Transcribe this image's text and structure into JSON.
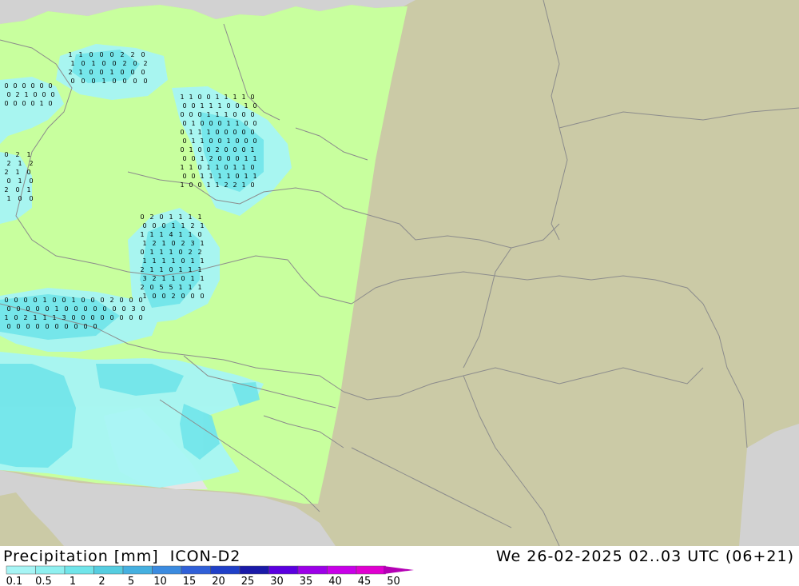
{
  "header": {
    "variable": "Precipitation [mm]",
    "model": "ICON-D2",
    "valid_time": "We 26-02-2025 02..03 UTC (06+21)"
  },
  "legend": {
    "ticks": [
      "0.1",
      "0.5",
      "1",
      "2",
      "5",
      "10",
      "15",
      "20",
      "25",
      "30",
      "35",
      "40",
      "45",
      "50"
    ],
    "colors": [
      "#a7f5f5",
      "#8ff0f0",
      "#70e5ea",
      "#55cde0",
      "#45b0e0",
      "#3b8be0",
      "#3060d8",
      "#2040c8",
      "#1a1aa8",
      "#5b00e0",
      "#9c00e8",
      "#c800e8",
      "#e000d0",
      "#b400b4"
    ]
  },
  "map": {
    "colors": {
      "domain": "#c8ff9e",
      "outside": "#cbcaa6",
      "sea": "#d2d2d2",
      "border": "#8c8c8c",
      "rain_light": "#a7f5f5",
      "rain_mid": "#70e5ea",
      "value_text": "#000000"
    },
    "values": [
      "1",
      "1",
      "0",
      "0",
      "0",
      "2",
      "2",
      "0",
      "1",
      "0",
      "1",
      "0",
      "0",
      "2",
      "0",
      "2",
      "2",
      "1",
      "0",
      "0",
      "1",
      "0",
      "0",
      "0",
      "0",
      "0",
      "0",
      "1",
      "0",
      "0",
      "0",
      "0",
      "0",
      "0",
      "0",
      "0",
      "0",
      "0",
      "0",
      "2",
      "1",
      "0",
      "0",
      "0",
      "0",
      "0",
      "0",
      "0",
      "1",
      "0",
      "1",
      "1",
      "0",
      "0",
      "1",
      "1",
      "1",
      "1",
      "0",
      "0",
      "0",
      "1",
      "1",
      "1",
      "0",
      "0",
      "1",
      "0",
      "0",
      "0",
      "0",
      "1",
      "1",
      "1",
      "0",
      "0",
      "0",
      "0",
      "1",
      "0",
      "0",
      "0",
      "1",
      "1",
      "0",
      "0",
      "0",
      "1",
      "1",
      "1",
      "0",
      "0",
      "0",
      "0",
      "0",
      "0",
      "1",
      "1",
      "0",
      "0",
      "1",
      "0",
      "0",
      "0",
      "0",
      "1",
      "0",
      "0",
      "2",
      "0",
      "0",
      "0",
      "1",
      "0",
      "0",
      "1",
      "2",
      "0",
      "0",
      "0",
      "1",
      "1",
      "1",
      "1",
      "0",
      "1",
      "1",
      "0",
      "1",
      "1",
      "0",
      "0",
      "0",
      "1",
      "1",
      "1",
      "1",
      "0",
      "1",
      "1",
      "1",
      "0",
      "0",
      "1",
      "1",
      "2",
      "2",
      "1",
      "0",
      "0",
      "2",
      "1",
      "2",
      "1",
      "2",
      "2",
      "1",
      "0",
      "0",
      "1",
      "0",
      "2",
      "0",
      "1",
      "1",
      "0",
      "0",
      "0",
      "2",
      "0",
      "1",
      "1",
      "1",
      "1",
      "0",
      "0",
      "0",
      "1",
      "1",
      "2",
      "1",
      "1",
      "1",
      "1",
      "4",
      "1",
      "1",
      "0",
      "1",
      "2",
      "1",
      "0",
      "2",
      "3",
      "1",
      "0",
      "1",
      "1",
      "1",
      "0",
      "2",
      "2",
      "1",
      "1",
      "1",
      "1",
      "0",
      "1",
      "1",
      "2",
      "1",
      "1",
      "0",
      "1",
      "1",
      "1",
      "3",
      "2",
      "1",
      "1",
      "0",
      "1",
      "1",
      "2",
      "0",
      "5",
      "5",
      "1",
      "1",
      "1",
      "1",
      "0",
      "0",
      "2",
      "0",
      "0",
      "0",
      "0",
      "0",
      "0",
      "0",
      "1",
      "0",
      "0",
      "1",
      "0",
      "0",
      "0",
      "2",
      "0",
      "0",
      "0",
      "0",
      "0",
      "0",
      "0",
      "0",
      "1",
      "0",
      "0",
      "0",
      "0",
      "0",
      "0",
      "0",
      "3",
      "0",
      "1",
      "0",
      "2",
      "1",
      "1",
      "1",
      "3",
      "0",
      "0",
      "0",
      "0",
      "0",
      "0",
      "0",
      "0",
      "0",
      "0",
      "0",
      "0",
      "0",
      "0",
      "0",
      "0",
      "0",
      "0"
    ]
  }
}
